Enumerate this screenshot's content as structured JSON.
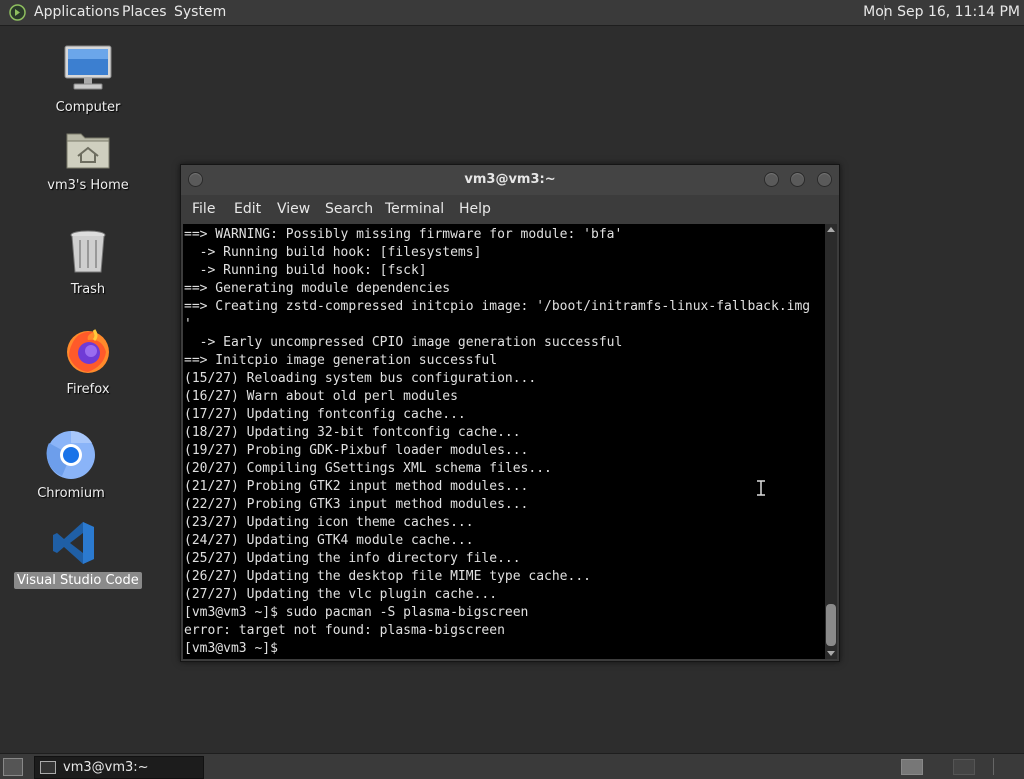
{
  "top_panel": {
    "menus": [
      "Applications",
      "Places",
      "System"
    ],
    "clock": "Mon Sep 16, 11:14 PM"
  },
  "desktop": {
    "icons": [
      {
        "label": "Computer"
      },
      {
        "label": "vm3's Home"
      },
      {
        "label": "Trash"
      },
      {
        "label": "Firefox"
      },
      {
        "label": "Chromium"
      },
      {
        "label": "Visual Studio Code"
      }
    ]
  },
  "terminal": {
    "title": "vm3@vm3:~",
    "menu": [
      "File",
      "Edit",
      "View",
      "Search",
      "Terminal",
      "Help"
    ],
    "lines": [
      "==> WARNING: Possibly missing firmware for module: 'bfa'",
      "  -> Running build hook: [filesystems]",
      "  -> Running build hook: [fsck]",
      "==> Generating module dependencies",
      "==> Creating zstd-compressed initcpio image: '/boot/initramfs-linux-fallback.img",
      "'",
      "  -> Early uncompressed CPIO image generation successful",
      "==> Initcpio image generation successful",
      "(15/27) Reloading system bus configuration...",
      "(16/27) Warn about old perl modules",
      "(17/27) Updating fontconfig cache...",
      "(18/27) Updating 32-bit fontconfig cache...",
      "(19/27) Probing GDK-Pixbuf loader modules...",
      "(20/27) Compiling GSettings XML schema files...",
      "(21/27) Probing GTK2 input method modules...",
      "(22/27) Probing GTK3 input method modules...",
      "(23/27) Updating icon theme caches...",
      "(24/27) Updating GTK4 module cache...",
      "(25/27) Updating the info directory file...",
      "(26/27) Updating the desktop file MIME type cache...",
      "(27/27) Updating the vlc plugin cache...",
      "[vm3@vm3 ~]$ sudo pacman -S plasma-bigscreen",
      "error: target not found: plasma-bigscreen",
      "[vm3@vm3 ~]$ "
    ]
  },
  "taskbar": {
    "window_button": "vm3@vm3:~"
  },
  "colors": {
    "panel": "#3a3a3a",
    "desktop": "#2d2d2d",
    "terminal_bg": "#000000",
    "terminal_fg": "#e0e0e0"
  }
}
